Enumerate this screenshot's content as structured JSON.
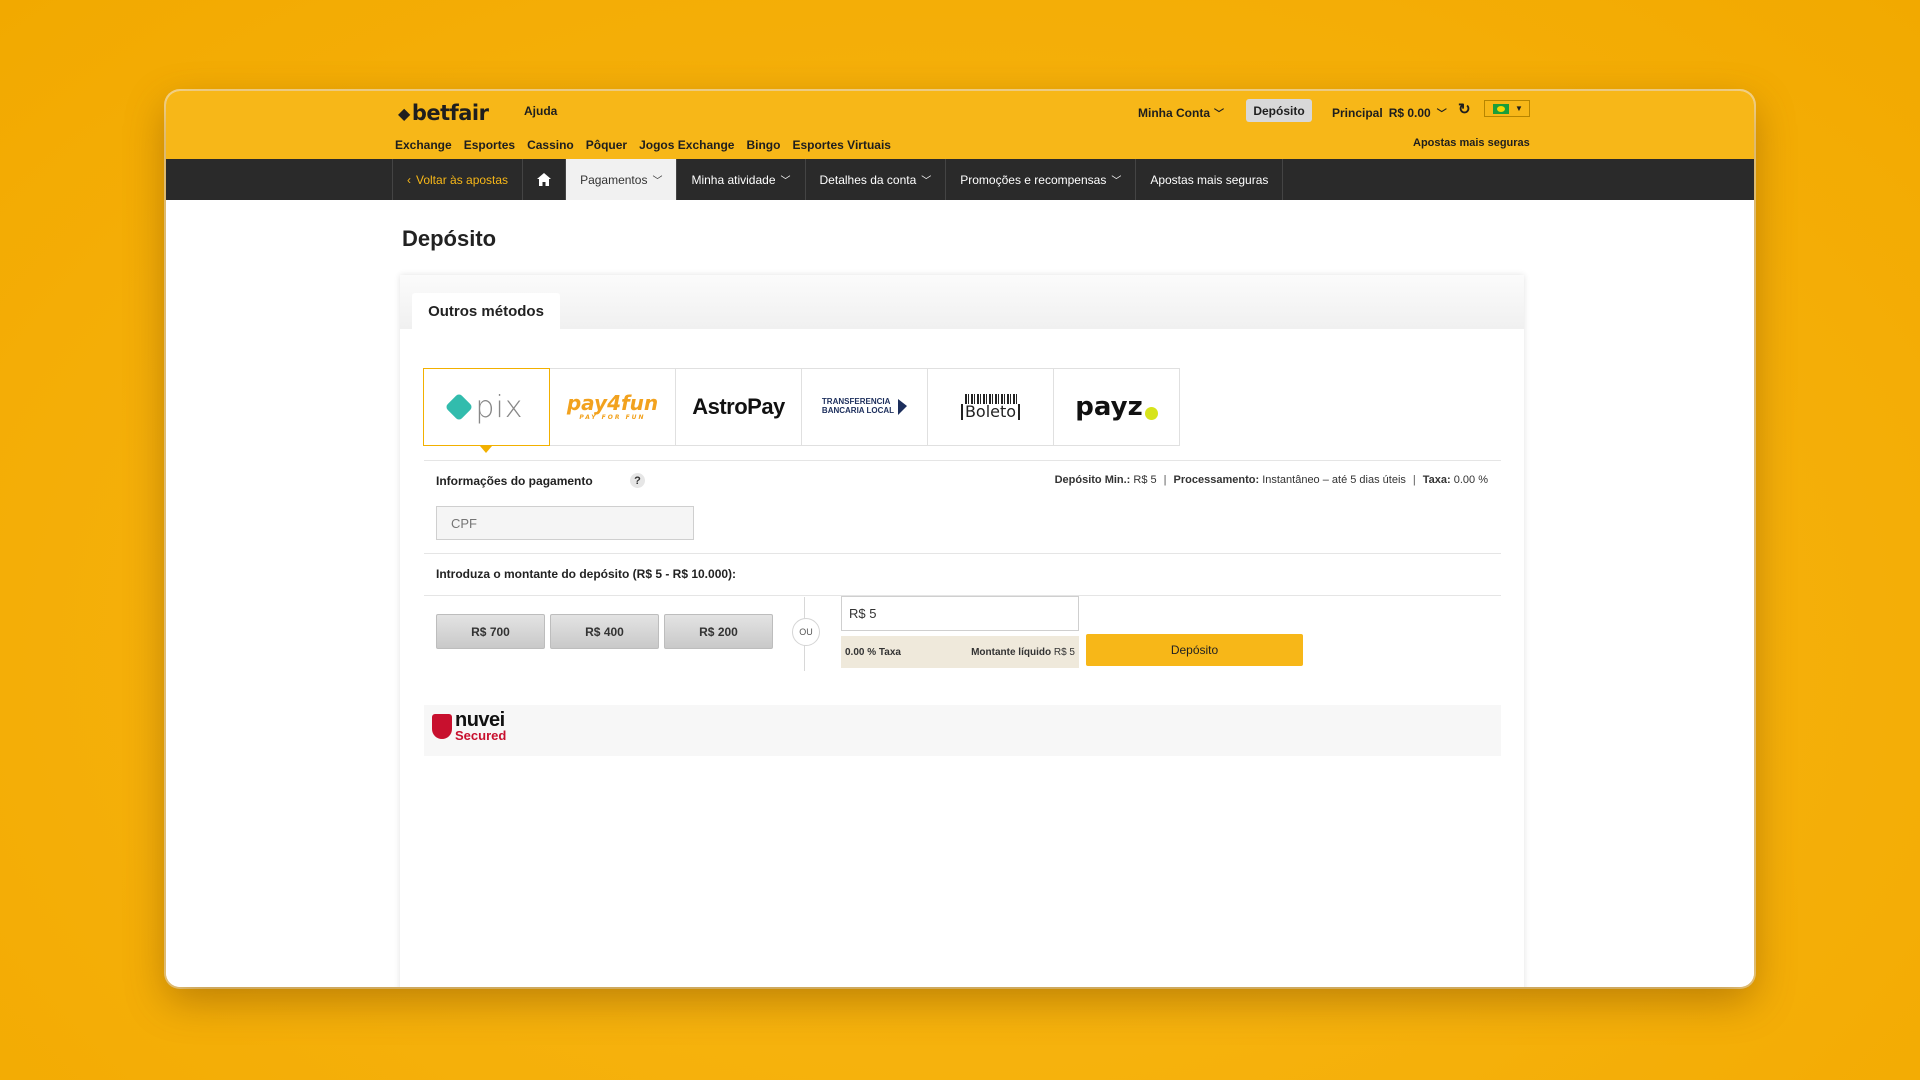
{
  "header": {
    "logo_text": "betfair",
    "help": "Ajuda",
    "nav": [
      "Exchange",
      "Esportes",
      "Cassino",
      "Pôquer",
      "Jogos Exchange",
      "Bingo",
      "Esportes Virtuais"
    ],
    "account": "Minha Conta",
    "deposit": "Depósito",
    "balance_label": "Principal",
    "balance_value": "R$  0.00",
    "safer_link": "Apostas mais seguras",
    "brand_color": "#f7b718"
  },
  "subnav": {
    "back": "Voltar às apostas",
    "items": [
      "Pagamentos",
      "Minha atividade",
      "Detalhes da conta",
      "Promoções e recompensas",
      "Apostas mais seguras"
    ]
  },
  "page": {
    "title": "Depósito",
    "tab": "Outros métodos",
    "methods": {
      "pix": "pix",
      "pay4fun": "pay4fun",
      "pay4fun_tag": "PAY FOR FUN",
      "astropay": "AstroPay",
      "tbl_1": "TRANSFERENCIA",
      "tbl_2": "BANCARIA LOCAL",
      "boleto": "Boleto",
      "payz": "payz"
    },
    "payment_info_label": "Informações do pagamento",
    "help_icon": "?",
    "min_label": "Depósito Min.:",
    "min_value": "R$ 5",
    "processing_label": "Processamento:",
    "processing_value": "Instantâneo – até 5 dias úteis",
    "fee_label": "Taxa:",
    "fee_value": "0.00 %",
    "cpf_placeholder": "CPF",
    "amount_label": "Introduza o montante do depósito (R$ 5 - R$ 10.000):",
    "quick_amounts": [
      "R$ 700",
      "R$ 400",
      "R$ 200"
    ],
    "or": "OU",
    "amount_value": "R$ 5",
    "fee_summary": "0.00 % Taxa",
    "net_label": "Montante líquido",
    "net_value": "R$ 5",
    "submit": "Depósito",
    "nuvei_1": "nuvei",
    "nuvei_2": "Secured"
  }
}
